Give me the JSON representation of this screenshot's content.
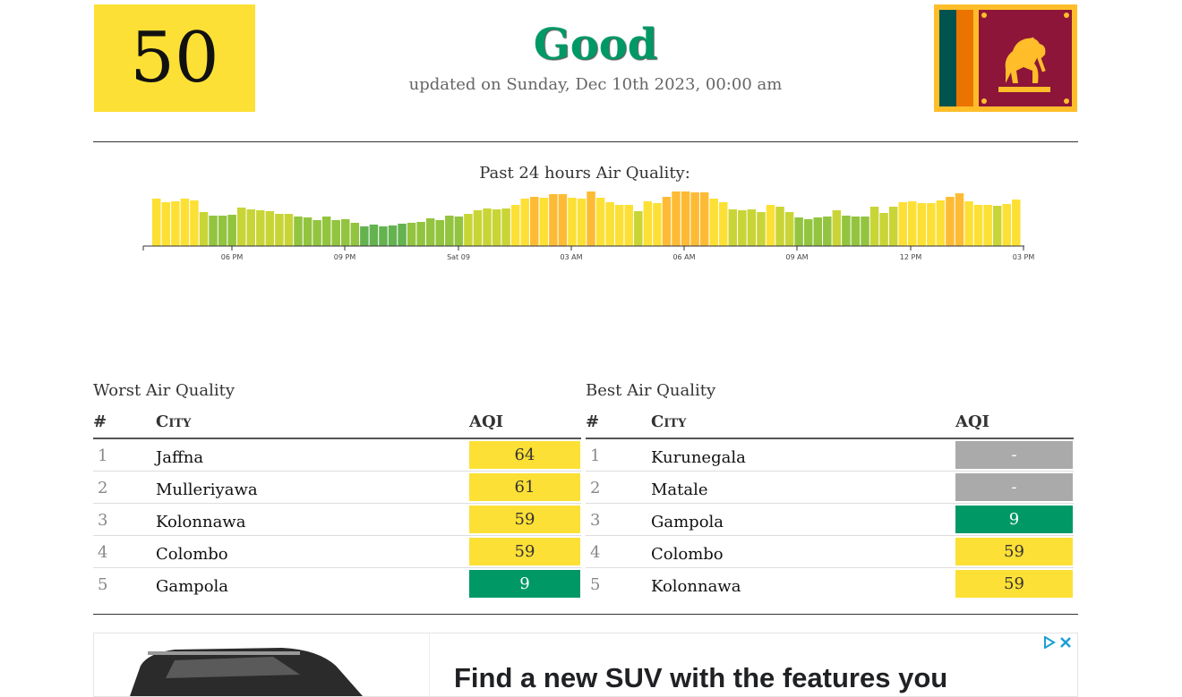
{
  "current": {
    "aqi": "50",
    "status": "Good",
    "updated": "updated on Sunday, Dec 10th 2023, 00:00 am",
    "box_color": "#fde035",
    "status_color": "#009966"
  },
  "flag": {
    "icon": "sri-lanka-flag-icon"
  },
  "chart": {
    "title": "Past 24 hours Air Quality:",
    "tick_labels": [
      "06 PM",
      "09 PM",
      "Sat 09",
      "03 AM",
      "06 AM",
      "09 AM",
      "12 PM",
      "03 PM"
    ]
  },
  "chart_data": {
    "type": "bar",
    "title": "Past 24 hours Air Quality:",
    "xlabel": "",
    "ylabel": "",
    "categories": [
      "06 PM",
      "09 PM",
      "Sat 09",
      "03 AM",
      "06 AM",
      "09 AM",
      "12 PM",
      "03 PM"
    ],
    "values": [
      53,
      49,
      50,
      53,
      51,
      38,
      34,
      34,
      35,
      43,
      41,
      40,
      39,
      36,
      36,
      33,
      32,
      29,
      33,
      29,
      30,
      26,
      22,
      24,
      22,
      23,
      25,
      26,
      27,
      31,
      29,
      34,
      33,
      36,
      40,
      42,
      41,
      42,
      46,
      53,
      55,
      54,
      58,
      58,
      54,
      53,
      61,
      54,
      49,
      46,
      46,
      39,
      50,
      48,
      55,
      61,
      61,
      60,
      60,
      53,
      49,
      41,
      40,
      41,
      38,
      46,
      44,
      38,
      32,
      30,
      32,
      33,
      40,
      34,
      33,
      33,
      44,
      37,
      44,
      49,
      50,
      48,
      48,
      51,
      55,
      59,
      50,
      46,
      46,
      45,
      47,
      52
    ],
    "ylim": [
      0,
      70
    ],
    "grid": false,
    "legend": "none",
    "color_scale": [
      {
        "max": 25,
        "color": "#64b350"
      },
      {
        "max": 35,
        "color": "#93c43f"
      },
      {
        "max": 45,
        "color": "#c9d537"
      },
      {
        "max": 54,
        "color": "#fde035"
      },
      {
        "max": 70,
        "color": "#fdbb35"
      }
    ]
  },
  "worst": {
    "title": "Worst Air Quality",
    "headers": {
      "rank": "#",
      "city": "City",
      "aqi": "AQI"
    },
    "rows": [
      {
        "rank": "1",
        "city": "Jaffna",
        "aqi": "64",
        "color": "#fde035"
      },
      {
        "rank": "2",
        "city": "Mulleriyawa",
        "aqi": "61",
        "color": "#fde035"
      },
      {
        "rank": "3",
        "city": "Kolonnawa",
        "aqi": "59",
        "color": "#fde035"
      },
      {
        "rank": "4",
        "city": "Colombo",
        "aqi": "59",
        "color": "#fde035"
      },
      {
        "rank": "5",
        "city": "Gampola",
        "aqi": "9",
        "color": "#009966"
      }
    ]
  },
  "best": {
    "title": "Best Air Quality",
    "headers": {
      "rank": "#",
      "city": "City",
      "aqi": "AQI"
    },
    "rows": [
      {
        "rank": "1",
        "city": "Kurunegala",
        "aqi": "-",
        "color": "#aaaaaa"
      },
      {
        "rank": "2",
        "city": "Matale",
        "aqi": "-",
        "color": "#aaaaaa"
      },
      {
        "rank": "3",
        "city": "Gampola",
        "aqi": "9",
        "color": "#009966"
      },
      {
        "rank": "4",
        "city": "Colombo",
        "aqi": "59",
        "color": "#fde035"
      },
      {
        "rank": "5",
        "city": "Kolonnawa",
        "aqi": "59",
        "color": "#fde035"
      }
    ]
  },
  "ad": {
    "headline": "Find a new SUV with the features you",
    "image": "suv-car-icon",
    "icons": [
      "adchoices-icon",
      "close-icon"
    ]
  }
}
